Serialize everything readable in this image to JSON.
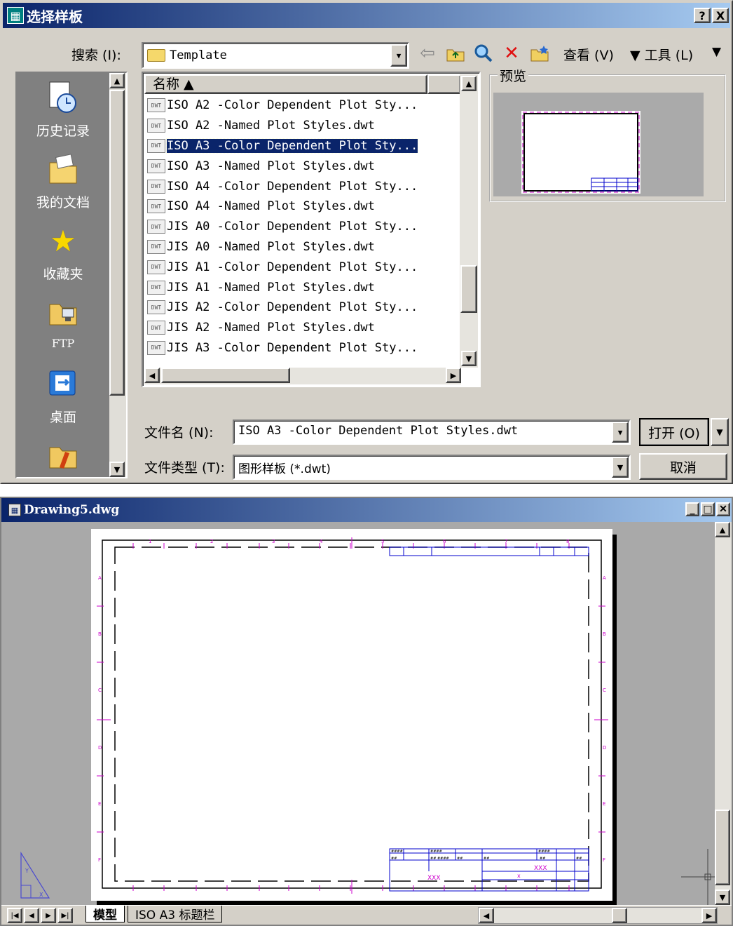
{
  "dialog": {
    "title": "选择样板",
    "help_label": "?",
    "close_label": "X",
    "search_label": "搜索 (I):",
    "search_value": "Template",
    "view_menu": "查看 (V)",
    "tools_menu": "▼ 工具 (L)",
    "more_menu": "▼",
    "places": [
      {
        "label": "历史记录",
        "icon": "history-icon"
      },
      {
        "label": "我的文档",
        "icon": "documents-icon"
      },
      {
        "label": "收藏夹",
        "icon": "favorites-icon"
      },
      {
        "label": "FTP",
        "icon": "ftp-icon"
      },
      {
        "label": "桌面",
        "icon": "desktop-icon"
      },
      {
        "label": "",
        "icon": "buzzsaw-icon"
      }
    ],
    "list_header": "名称 ▲",
    "files": [
      "ISO A2 -Color Dependent Plot Sty...",
      "ISO A2 -Named Plot Styles.dwt",
      "ISO A3 -Color Dependent Plot Sty...",
      "ISO A3 -Named Plot Styles.dwt",
      "ISO A4 -Color Dependent Plot Sty...",
      "ISO A4 -Named Plot Styles.dwt",
      "JIS A0 -Color Dependent Plot Sty...",
      "JIS A0 -Named Plot Styles.dwt",
      "JIS A1 -Color Dependent Plot Sty...",
      "JIS A1 -Named Plot Styles.dwt",
      "JIS A2 -Color Dependent Plot Sty...",
      "JIS A2 -Named Plot Styles.dwt",
      "JIS A3 -Color Dependent Plot Sty..."
    ],
    "file_icon_label": "DWT",
    "preview_label": "预览",
    "filename_label": "文件名 (N):",
    "filename_value": "ISO A3 -Color Dependent Plot Styles.dwt",
    "filetype_label": "文件类型 (T):",
    "filetype_value": "图形样板 (*.dwt)",
    "open_button": "打开 (O)",
    "cancel_button": "取消"
  },
  "drawing": {
    "title": "Drawing5.dwg",
    "title_block_value_1": "XXX",
    "title_block_value_2": "XXX",
    "title_block_value_3": "x",
    "tabs": {
      "model": "模型",
      "layout": "ISO A3 标题栏"
    }
  },
  "colors": {
    "titlebar": "#0a246a",
    "selection": "#0a246a",
    "magenta": "#cc00cc",
    "blue": "#0000cc"
  }
}
